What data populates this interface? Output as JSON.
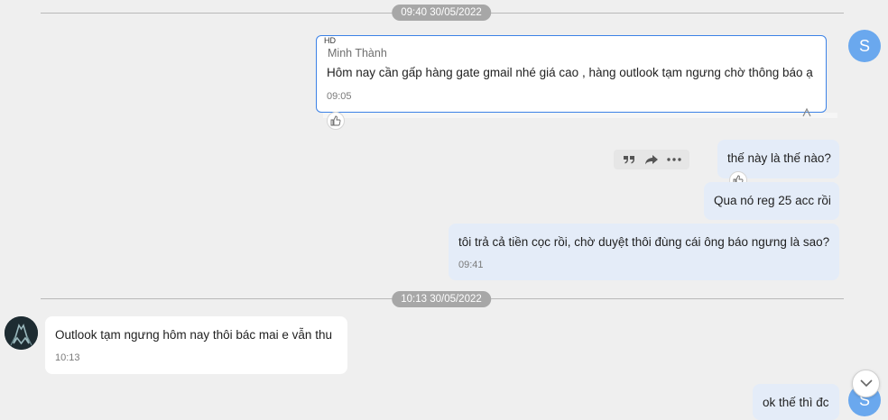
{
  "dividers": [
    {
      "date_label": "09:40 30/05/2022"
    },
    {
      "date_label": "10:13 30/05/2022"
    }
  ],
  "self_avatar_letter": "S",
  "quoted_message": {
    "tag": "HD",
    "sender": "Minh Thành",
    "text": "Hôm nay cần gấp hàng gate gmail nhé giá cao , hàng outlook tạm ngưng chờ thông báo ạ",
    "time": "09:05"
  },
  "my_messages": [
    {
      "text": "thế này là thế nào?"
    },
    {
      "text": "Qua nó reg 25 acc rồi"
    },
    {
      "text": "tôi trả cả tiền cọc rồi, chờ duyệt thôi đùng cái ông báo ngưng là sao?",
      "time": "09:41"
    }
  ],
  "their_message": {
    "text": "Outlook tạm ngưng hôm nay thôi bác mai e vẫn thu",
    "time": "10:13"
  },
  "last_message": {
    "text": "ok thế thì đc"
  },
  "toolbar_icons": [
    "quote-icon",
    "forward-icon",
    "more-icon"
  ],
  "colors": {
    "background": "#efefef",
    "my_bubble": "#e4ecf8",
    "their_bubble": "#ffffff",
    "quote_border": "#3c82e6",
    "avatar": "#6aa8ee",
    "date_pill": "#a7a7a7"
  }
}
